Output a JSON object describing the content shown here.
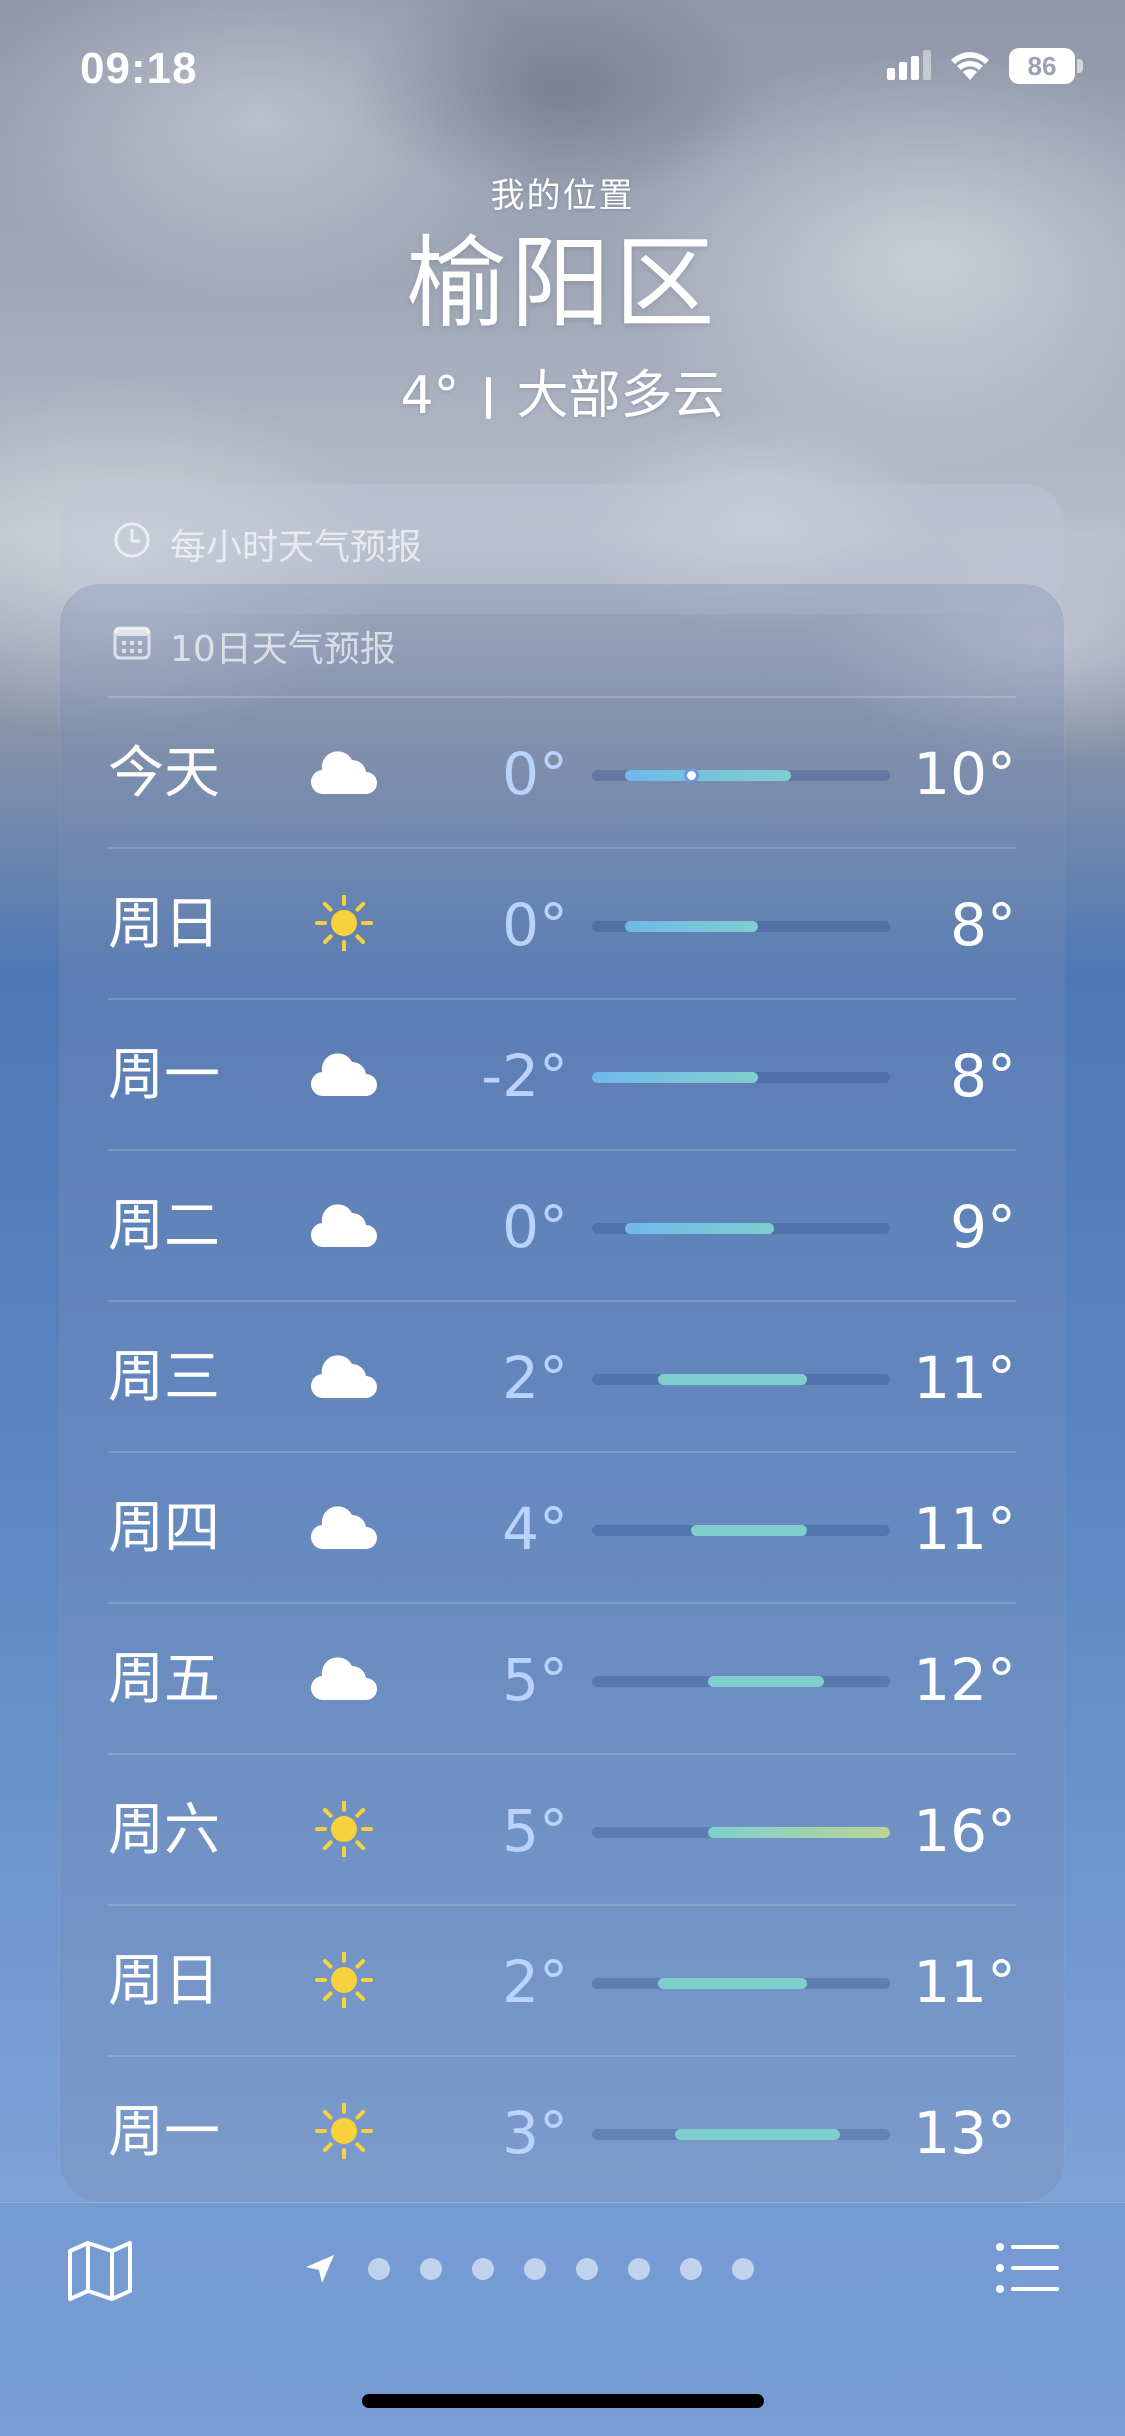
{
  "status_bar": {
    "time": "09:18",
    "battery": "86"
  },
  "header": {
    "my_location": "我的位置",
    "city": "榆阳区",
    "current_temp": "4°",
    "condition": "大部多云"
  },
  "hourly": {
    "title": "每小时天气预报",
    "icon": "clock-icon"
  },
  "daily": {
    "title": "10日天气预报",
    "icon": "calendar-icon",
    "range_min": -2,
    "range_max": 16,
    "current_temp_value": 4,
    "days": [
      {
        "name": "今天",
        "icon": "cloud-icon",
        "low": "0°",
        "high": "10°",
        "low_v": 0,
        "high_v": 10,
        "current": true
      },
      {
        "name": "周日",
        "icon": "sun-icon",
        "low": "0°",
        "high": "8°",
        "low_v": 0,
        "high_v": 8
      },
      {
        "name": "周一",
        "icon": "cloud-icon",
        "low": "-2°",
        "high": "8°",
        "low_v": -2,
        "high_v": 8
      },
      {
        "name": "周二",
        "icon": "cloud-icon",
        "low": "0°",
        "high": "9°",
        "low_v": 0,
        "high_v": 9
      },
      {
        "name": "周三",
        "icon": "cloud-icon",
        "low": "2°",
        "high": "11°",
        "low_v": 2,
        "high_v": 11
      },
      {
        "name": "周四",
        "icon": "cloud-icon",
        "low": "4°",
        "high": "11°",
        "low_v": 4,
        "high_v": 11
      },
      {
        "name": "周五",
        "icon": "cloud-icon",
        "low": "5°",
        "high": "12°",
        "low_v": 5,
        "high_v": 12
      },
      {
        "name": "周六",
        "icon": "sun-icon",
        "low": "5°",
        "high": "16°",
        "low_v": 5,
        "high_v": 16
      },
      {
        "name": "周日",
        "icon": "sun-icon",
        "low": "2°",
        "high": "11°",
        "low_v": 2,
        "high_v": 11
      },
      {
        "name": "周一",
        "icon": "sun-icon",
        "low": "3°",
        "high": "13°",
        "low_v": 3,
        "high_v": 13
      }
    ]
  },
  "bottom_bar": {
    "map_icon": "map-icon",
    "list_icon": "list-icon",
    "location_icon": "location-arrow-icon",
    "page_count": 8
  },
  "colors": {
    "bar_cool": "#6fb8ea",
    "bar_mild": "#7fcfcf",
    "bar_warm": "#b9d596",
    "sun": "#f7d23c",
    "low_temp": "#bed7ff"
  }
}
